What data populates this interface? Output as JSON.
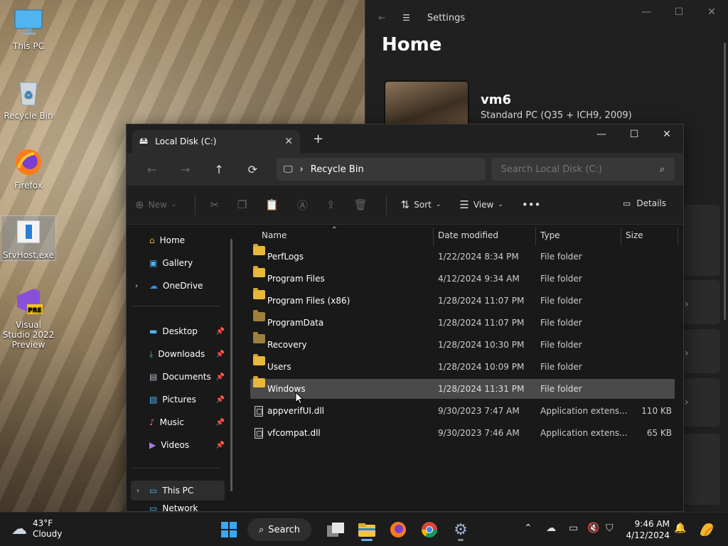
{
  "desktop": {
    "icons": [
      {
        "label": "This PC"
      },
      {
        "label": "Recycle Bin"
      },
      {
        "label": "Firefox"
      },
      {
        "label": "SrvHost.exe"
      },
      {
        "label": "Visual Studio 2022 Preview"
      }
    ]
  },
  "settings": {
    "title": "Settings",
    "heading": "Home",
    "pc_name": "vm6",
    "pc_desc": "Standard PC (Q35 + ICH9, 2009)"
  },
  "explorer": {
    "tab_label": "Local Disk (C:)",
    "address": "Recycle Bin",
    "search_placeholder": "Search Local Disk (C:)",
    "commands": {
      "new": "New",
      "sort": "Sort",
      "view": "View",
      "details": "Details"
    },
    "nav": {
      "home": "Home",
      "gallery": "Gallery",
      "onedrive": "OneDrive",
      "desktop": "Desktop",
      "downloads": "Downloads",
      "documents": "Documents",
      "pictures": "Pictures",
      "music": "Music",
      "videos": "Videos",
      "thispc": "This PC",
      "network": "Network"
    },
    "columns": {
      "name": "Name",
      "date": "Date modified",
      "type": "Type",
      "size": "Size"
    },
    "rows": [
      {
        "name": "PerfLogs",
        "date": "1/22/2024 8:34 PM",
        "type": "File folder",
        "size": ""
      },
      {
        "name": "Program Files",
        "date": "4/12/2024 9:34 AM",
        "type": "File folder",
        "size": ""
      },
      {
        "name": "Program Files (x86)",
        "date": "1/28/2024 11:07 PM",
        "type": "File folder",
        "size": ""
      },
      {
        "name": "ProgramData",
        "date": "1/28/2024 11:07 PM",
        "type": "File folder",
        "size": ""
      },
      {
        "name": "Recovery",
        "date": "1/28/2024 10:30 PM",
        "type": "File folder",
        "size": ""
      },
      {
        "name": "Users",
        "date": "1/28/2024 10:09 PM",
        "type": "File folder",
        "size": ""
      },
      {
        "name": "Windows",
        "date": "1/28/2024 11:31 PM",
        "type": "File folder",
        "size": ""
      },
      {
        "name": "appverifUI.dll",
        "date": "9/30/2023 7:47 AM",
        "type": "Application extens...",
        "size": "110 KB"
      },
      {
        "name": "vfcompat.dll",
        "date": "9/30/2023 7:46 AM",
        "type": "Application extens...",
        "size": "65 KB"
      }
    ]
  },
  "taskbar": {
    "temp": "43°F",
    "condition": "Cloudy",
    "search_label": "Search",
    "time": "9:46 AM",
    "date": "4/12/2024"
  },
  "colors": {
    "accent": "#6ab0f3",
    "folder": "#e8b83a"
  }
}
